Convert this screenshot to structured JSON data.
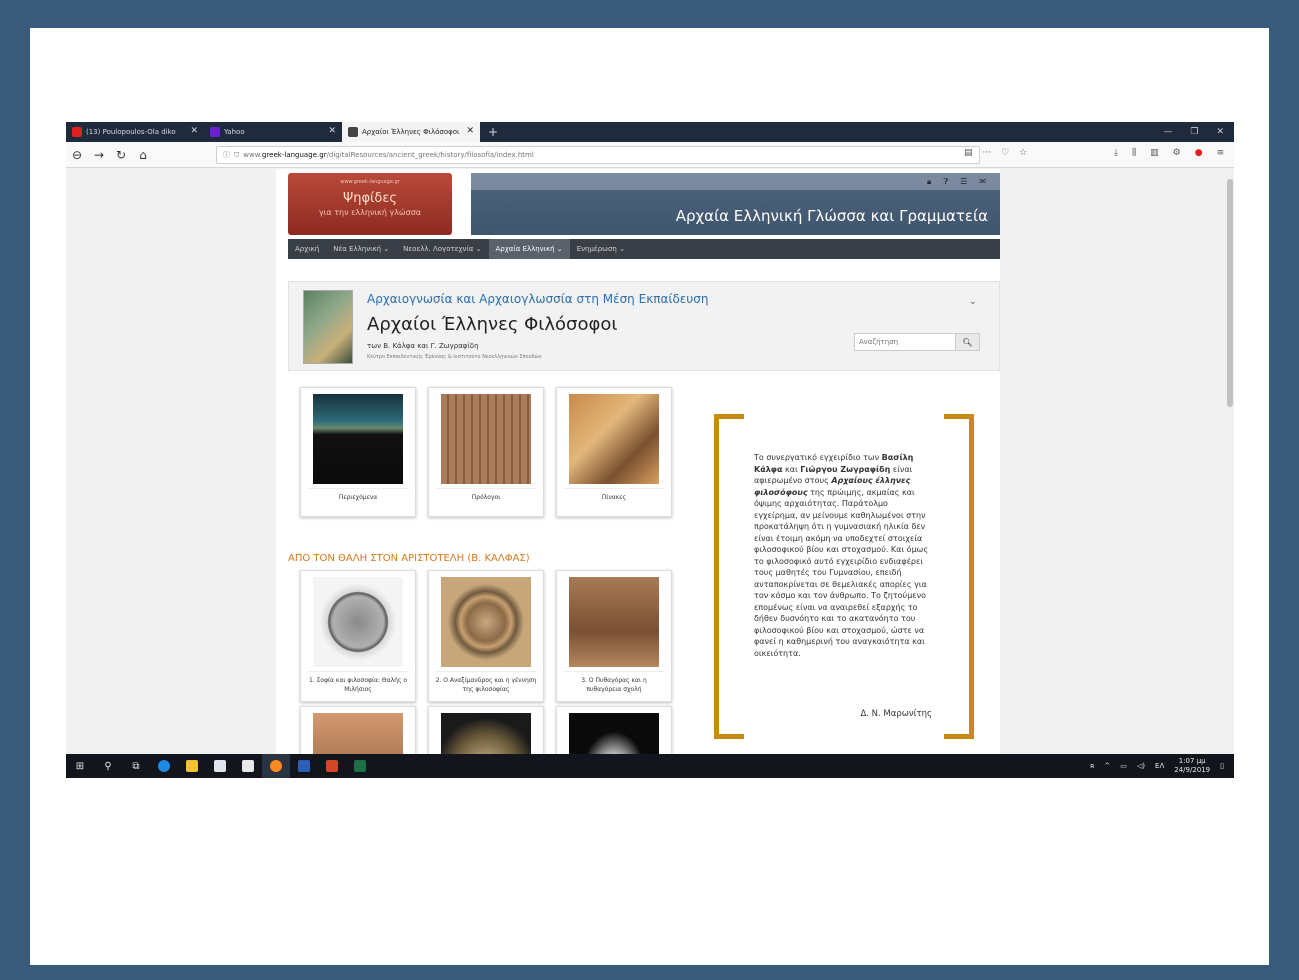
{
  "browser": {
    "tabs": [
      {
        "label": "(13) Poulopoulos-Ola diko",
        "favicon_color": "#e02020",
        "active": false
      },
      {
        "label": "Yahoo",
        "favicon_color": "#6b1fd0",
        "active": false
      },
      {
        "label": "Αρχαίοι Έλληνες Φιλόσοφοι",
        "favicon_color": "#444444",
        "active": true
      }
    ],
    "url_prefix": "www.",
    "url_domain": "greek-language.gr",
    "url_path": "/digitalResources/ancient_greek/history/filosofia/index.html"
  },
  "site": {
    "logo_small": "www.greek-language.gr",
    "logo_title": "Ψηφίδες",
    "logo_subtitle": "για την ελληνική γλώσσα",
    "banner_title": "Αρχαία Ελληνική Γλώσσα και Γραμματεία",
    "nav": [
      {
        "label": "Αρχική",
        "active": false
      },
      {
        "label": "Νέα Ελληνική ⌄",
        "active": false
      },
      {
        "label": "Νεοελλ. Λογοτεχνία ⌄",
        "active": false
      },
      {
        "label": "Αρχαία Ελληνική ⌄",
        "active": true
      },
      {
        "label": "Ενημέρωση ⌄",
        "active": false
      }
    ]
  },
  "header": {
    "series": "Αρχαιογνωσία και Αρχαιογλωσσία στη Μέση Εκπαίδευση",
    "title": "Αρχαίοι Έλληνες Φιλόσοφοι",
    "authors": "των Β. Κάλφα και Γ. Ζωγραφίδη",
    "institution": "Κέντρο Εκπαιδευτικής Έρευνας & Ινστιτούτο Νεοελληνικών Σπουδών",
    "search_placeholder": "Αναζήτηση"
  },
  "cards_top": [
    {
      "caption": "Περιεχόμενα"
    },
    {
      "caption": "Πρόλογοι"
    },
    {
      "caption": "Πίνακες"
    }
  ],
  "section_title": "ΑΠΟ ΤΟΝ ΘΑΛΗ ΣΤΟΝ ΑΡΙΣΤΟΤΕΛΗ (Β. ΚΑΛΦΑΣ)",
  "cards_section": [
    {
      "caption": "1. Σοφία και φιλοσοφία: Θαλής ο Μιλήσιος"
    },
    {
      "caption": "2. Ο Αναξίμανδρος και η γέννηση της φιλοσοφίας"
    },
    {
      "caption": "3. Ο Πυθαγόρας και η πυθαγόρεια σχολή"
    }
  ],
  "quote": {
    "p1": "Το συνεργατικό εγχειρίδιο των ",
    "b1": "Βασίλη Κάλφα",
    "p2": " και ",
    "b2": "Γιώργου Ζωγραφίδη",
    "p3": " είναι αφιερωμένο στους ",
    "b3": "Αρχαίους έλληνες φιλοσόφους",
    "p4": " της πρώιμης, ακμαίας και όψιμης αρχαιότητας. Παράτολμο εγχείρημα, αν μείνουμε καθηλωμένοι στην προκατάληψη ότι η γυμνασιακή ηλικία δεν είναι έτοιμη ακόμη να υποδεχτεί στοιχεία φιλοσοφικού βίου και στοχασμού. Και όμως το φιλοσοφικό αυτό εγχειρίδιο ενδιαφέρει τους μαθητές του Γυμνασίου, επειδή ανταποκρίνεται σε θεμελιακές απορίες για τον κόσμο και τον άνθρωπο. Το ζητούμενο επομένως είναι να αναιρεθεί εξαρχής το δήθεν δυσνόητο και το ακατανόητο του φιλοσοφικού βίου και στοχασμού, ώστε να φανεί η καθημερινή του αναγκαιότητα και οικειότητα.",
    "signature": "Δ. Ν. Μαρωνίτης"
  },
  "taskbar": {
    "lang": "ΕΛ",
    "time": "1:07 μμ",
    "date": "24/9/2019"
  },
  "colors": {
    "accent_orange": "#d6781c",
    "bracket_gold": "#c98a13",
    "series_blue": "#2b6fb0",
    "logo_red": "#b84a3a"
  }
}
